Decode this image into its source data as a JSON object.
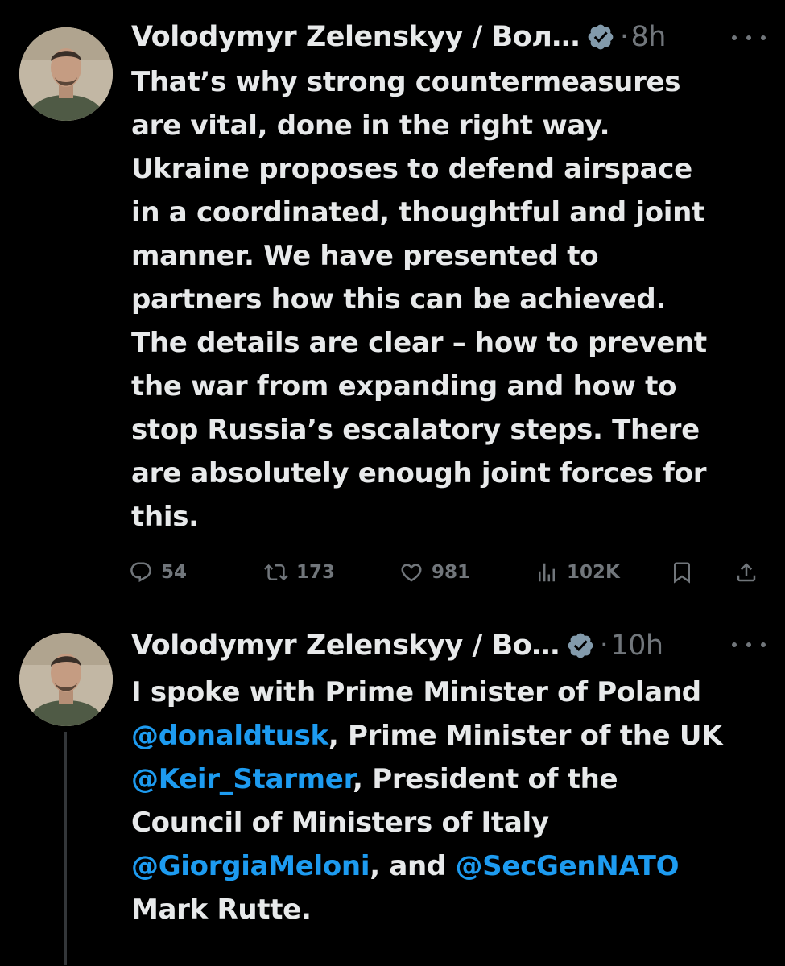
{
  "tweets": [
    {
      "author": "Volodymyr Zelenskyy / Вол…",
      "time": "8h",
      "dot": "·",
      "lines": [
        "That’s why strong countermeasures",
        "are vital, done in the right way.",
        "Ukraine proposes to defend airspace",
        "in a coordinated, thoughtful and joint",
        "manner. We have presented to",
        "partners how this can be achieved.",
        "The details are clear – how to prevent",
        "the war from expanding and how to",
        "stop Russia’s escalatory steps. There",
        "are absolutely enough joint forces for",
        "this."
      ],
      "stats": {
        "replies": "54",
        "reposts": "173",
        "likes": "981",
        "views": "102K"
      }
    },
    {
      "author": "Volodymyr Zelenskyy / Во…",
      "time": "10h",
      "dot": "·",
      "segments": {
        "l1": "I spoke with Prime Minister of Poland",
        "m1": "@donaldtusk",
        "l2": ", Prime Minister of the UK",
        "m2": "@Keir_Starmer",
        "l3": ", President of the",
        "l4": "Council of Ministers of Italy",
        "m3": "@GiorgiaMeloni",
        "l5": ", and ",
        "m4": "@SecGenNATO",
        "l6": "Mark Rutte."
      }
    }
  ],
  "colors": {
    "background": "#000000",
    "text": "#e7e9ea",
    "secondary": "#71767b",
    "mention": "#1d9bf0",
    "verified": "#829aab",
    "divider": "#2f3336"
  },
  "icons": [
    "avatar",
    "verified-badge-icon",
    "more-icon",
    "reply-icon",
    "repost-icon",
    "like-icon",
    "views-icon",
    "bookmark-icon",
    "share-icon"
  ]
}
